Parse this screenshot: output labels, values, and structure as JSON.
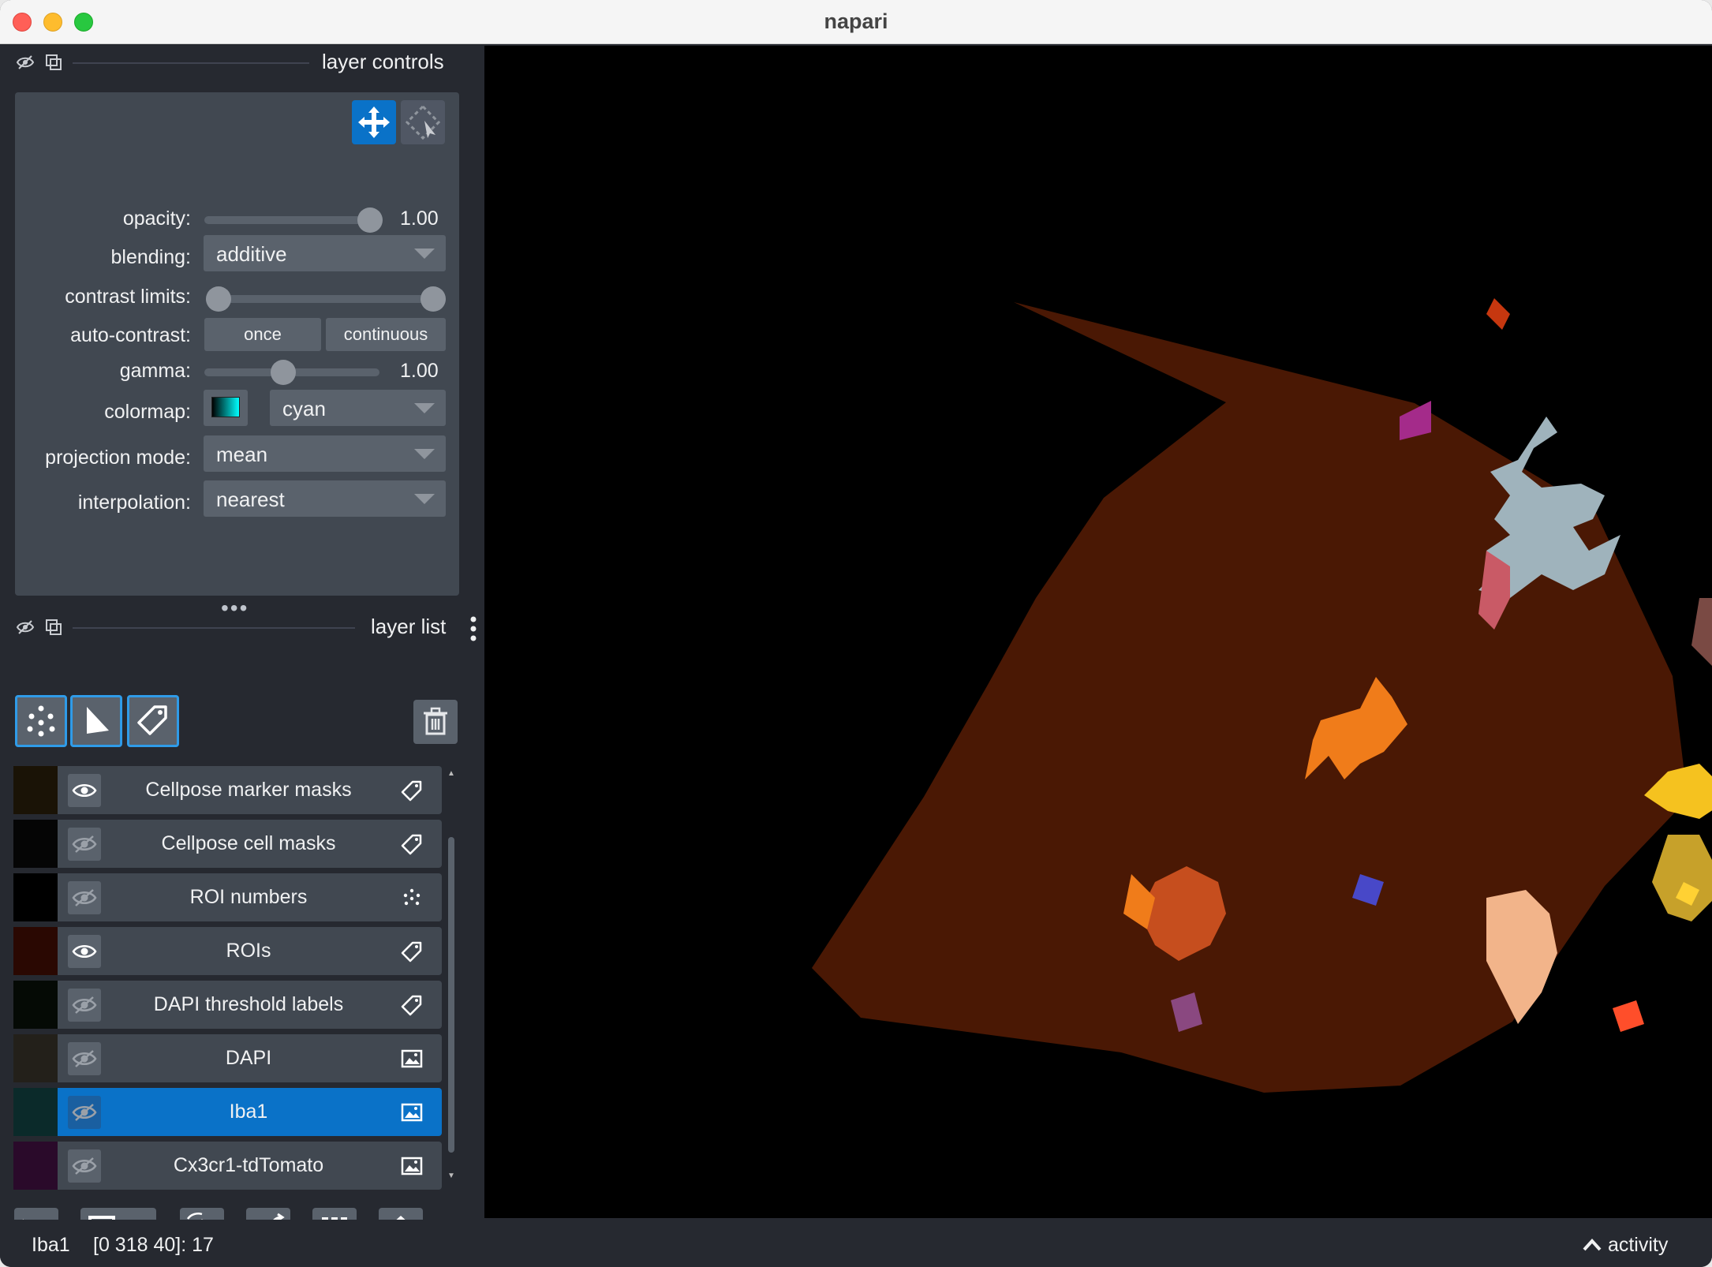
{
  "app": {
    "title": "napari"
  },
  "layer_controls": {
    "title": "layer controls",
    "opacity": {
      "label": "opacity:",
      "value": "1.00",
      "fraction": 1.0
    },
    "blending": {
      "label": "blending:",
      "value": "additive"
    },
    "contrast_limits": {
      "label": "contrast limits:",
      "low_fraction": 0.0,
      "high_fraction": 1.0
    },
    "auto_contrast": {
      "label": "auto-contrast:",
      "once_label": "once",
      "continuous_label": "continuous"
    },
    "gamma": {
      "label": "gamma:",
      "value": "1.00",
      "fraction": 0.45
    },
    "colormap": {
      "label": "colormap:",
      "value": "cyan"
    },
    "projection_mode": {
      "label": "projection mode:",
      "value": "mean"
    },
    "interpolation": {
      "label": "interpolation:",
      "value": "nearest"
    }
  },
  "layer_list": {
    "title": "layer list",
    "layers": [
      {
        "name": "Cellpose marker masks",
        "type": "labels",
        "visible": true,
        "selected": false
      },
      {
        "name": "Cellpose cell masks",
        "type": "labels",
        "visible": false,
        "selected": false
      },
      {
        "name": "ROI numbers",
        "type": "points",
        "visible": false,
        "selected": false
      },
      {
        "name": "ROIs",
        "type": "labels",
        "visible": true,
        "selected": false
      },
      {
        "name": "DAPI threshold labels",
        "type": "labels",
        "visible": false,
        "selected": false
      },
      {
        "name": "DAPI",
        "type": "image",
        "visible": false,
        "selected": false
      },
      {
        "name": "Iba1",
        "type": "image",
        "visible": false,
        "selected": true
      },
      {
        "name": "Cx3cr1-tdTomato",
        "type": "image",
        "visible": false,
        "selected": false
      }
    ]
  },
  "status": {
    "layer": "Iba1",
    "coords": "[0 318 40]: 17",
    "activity": "activity"
  },
  "colors": {
    "accent": "#0a72c8",
    "panel_bg": "#262930",
    "control_bg": "#414851",
    "roi_bg": "#4a1804"
  }
}
